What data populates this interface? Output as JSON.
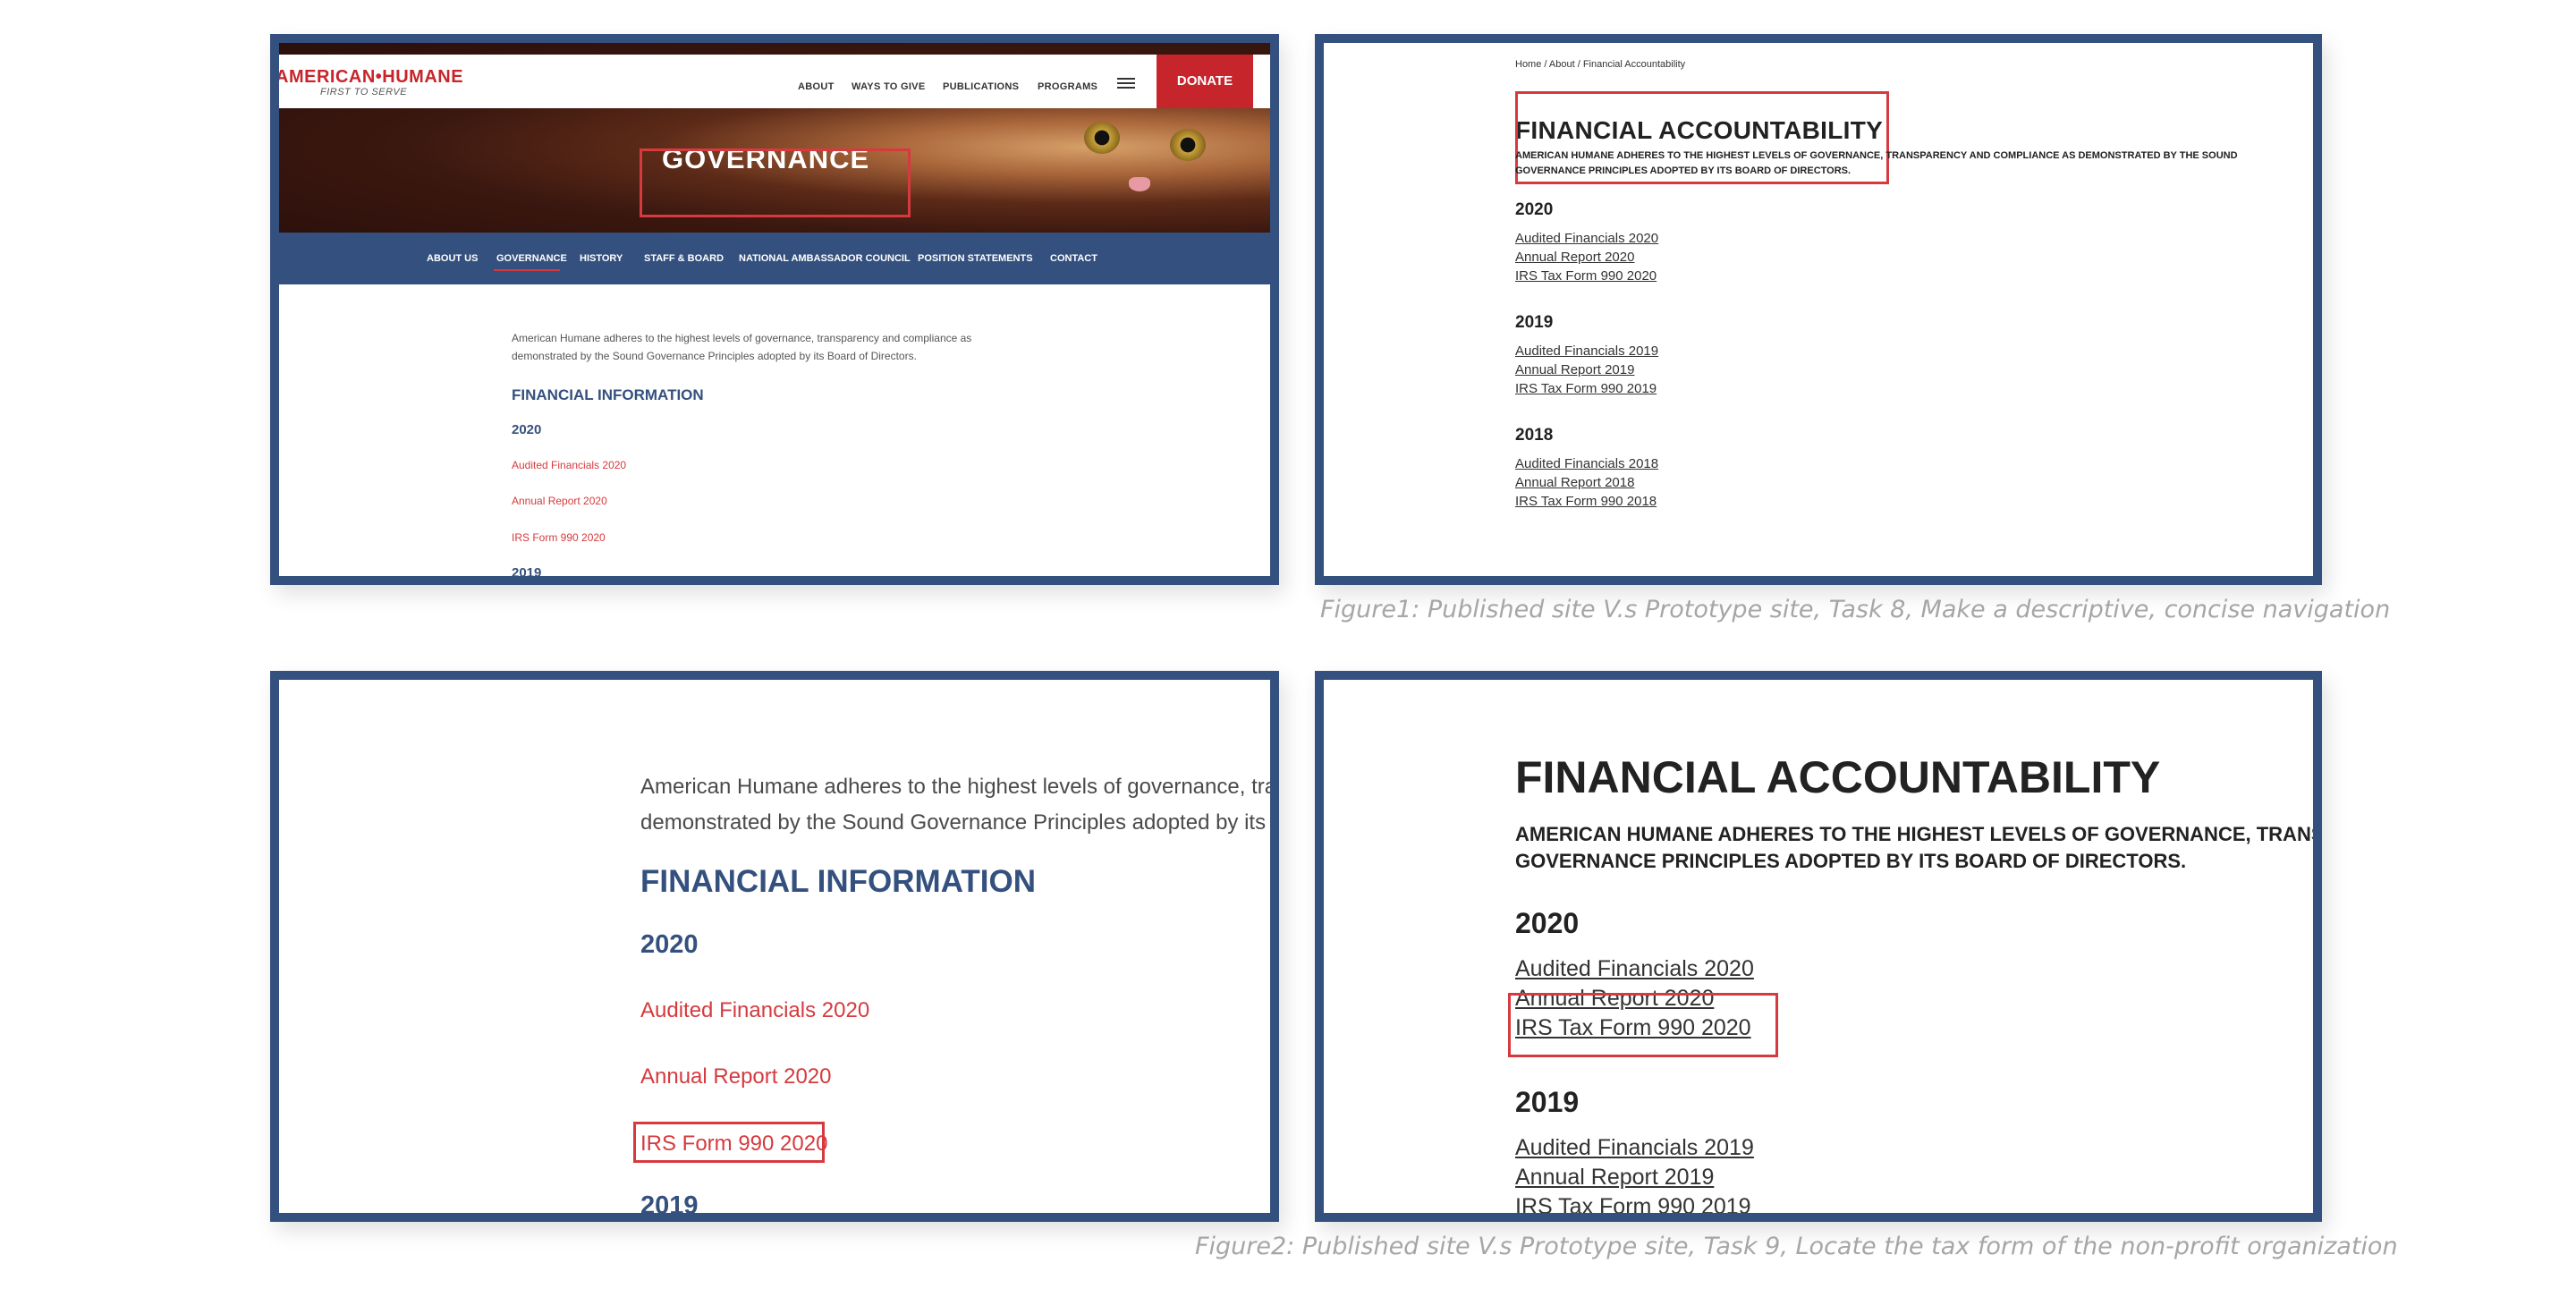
{
  "published_site": {
    "logo_text": "AMERICAN•HUMANE",
    "logo_tagline": "FIRST TO SERVE",
    "top_nav": [
      "ABOUT",
      "WAYS TO GIVE",
      "PUBLICATIONS",
      "PROGRAMS"
    ],
    "donate_label": "DONATE",
    "hero_title": "GOVERNANCE",
    "sub_nav": [
      "ABOUT US",
      "GOVERNANCE",
      "HISTORY",
      "STAFF & BOARD",
      "NATIONAL AMBASSADOR COUNCIL",
      "POSITION STATEMENTS",
      "CONTACT"
    ],
    "active_sub_nav": "GOVERNANCE",
    "intro_line1": "American Humane adheres to the highest levels of governance, transparency and compliance as",
    "intro_line2": "demonstrated by the Sound Governance Principles adopted by its Board of Directors.",
    "section_heading": "FINANCIAL INFORMATION",
    "year_2020": "2020",
    "links_2020": [
      "Audited Financials 2020",
      "Annual Report 2020",
      "IRS Form 990 2020"
    ],
    "year_2019": "2019"
  },
  "prototype_site": {
    "breadcrumb": "Home / About / Financial Accountability",
    "title": "FINANCIAL ACCOUNTABILITY",
    "desc_line1": "AMERICAN HUMANE ADHERES TO THE HIGHEST LEVELS OF GOVERNANCE, TRANSPARENCY AND COMPLIANCE AS DEMONSTRATED BY THE SOUND",
    "desc_line2": "GOVERNANCE PRINCIPLES ADOPTED BY ITS BOARD OF DIRECTORS.",
    "years": [
      {
        "year": "2020",
        "links": [
          "Audited Financials 2020",
          "Annual Report 2020",
          "IRS Tax Form 990 2020"
        ]
      },
      {
        "year": "2019",
        "links": [
          "Audited Financials 2019",
          "Annual Report 2019",
          "IRS Tax Form 990 2019"
        ]
      },
      {
        "year": "2018",
        "links": [
          "Audited Financials 2018",
          "Annual Report 2018",
          "IRS Tax Form 990 2018"
        ]
      }
    ]
  },
  "zoomed_published": {
    "intro_line1": "American Humane adheres to the highest levels of governance, transparency and compliance as",
    "intro_line2": "demonstrated by the Sound Governance Principles adopted by its Board of Directors."
  },
  "zoomed_prototype": {
    "desc_line1": "AMERICAN HUMANE ADHERES TO THE HIGHEST LEVELS OF GOVERNANCE, TRANSPARENCY AND COMPLIANCE AS DEMONSTRATED BY THE SOUND",
    "desc_line2": "GOVERNANCE PRINCIPLES ADOPTED BY ITS BOARD OF DIRECTORS."
  },
  "captions": {
    "figure1": "Figure1: Published site V.s Prototype site, Task 8, Make a descriptive, concise navigation",
    "figure2": "Figure2: Published site V.s Prototype site, Task 9, Locate the tax form of the non-profit organization"
  },
  "colors": {
    "frame": "#34507e",
    "highlight": "#d63a3e",
    "brand_red": "#c7252c",
    "brand_navy": "#34507e"
  }
}
